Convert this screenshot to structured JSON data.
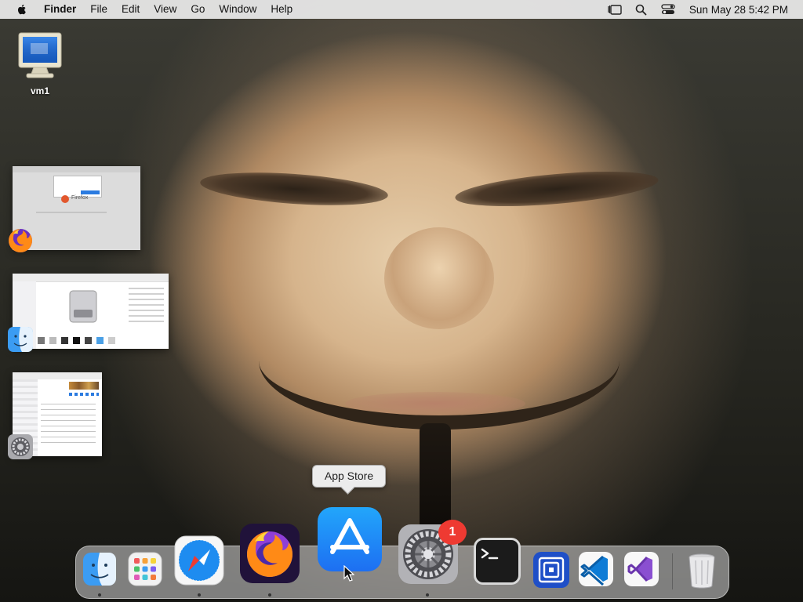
{
  "menubar": {
    "app_name": "Finder",
    "menus": [
      "File",
      "Edit",
      "View",
      "Go",
      "Window",
      "Help"
    ],
    "clock": "Sun May 28  5:42 PM",
    "status_icons": [
      "stage-manager-icon",
      "spotlight-search-icon",
      "control-center-icon"
    ]
  },
  "desktop": {
    "icons": [
      {
        "label": "vm1",
        "icon": "computer-monitor-icon"
      }
    ]
  },
  "stage_manager": {
    "groups": [
      {
        "app": "Firefox",
        "icon": "firefox-icon",
        "thumb_text": "Firefox"
      },
      {
        "app": "Finder",
        "icon": "finder-icon"
      },
      {
        "app": "System Preferences",
        "icon": "system-preferences-icon"
      }
    ]
  },
  "tooltip": {
    "text": "App Store"
  },
  "dock": {
    "items": [
      {
        "name": "Finder",
        "icon": "finder-icon",
        "running": true
      },
      {
        "name": "Launchpad",
        "icon": "launchpad-icon",
        "running": false
      },
      {
        "name": "Safari",
        "icon": "safari-icon",
        "running": true
      },
      {
        "name": "Firefox",
        "icon": "firefox-icon",
        "running": true
      },
      {
        "name": "App Store",
        "icon": "app-store-icon",
        "running": false
      },
      {
        "name": "System Preferences",
        "icon": "system-preferences-icon",
        "running": true,
        "badge": "1"
      },
      {
        "name": "Terminal",
        "icon": "terminal-icon",
        "running": false
      },
      {
        "name": "Remote Desktop",
        "icon": "remote-desktop-icon",
        "running": false
      },
      {
        "name": "Visual Studio Code",
        "icon": "vscode-icon",
        "running": false
      },
      {
        "name": "Visual Studio",
        "icon": "visual-studio-icon",
        "running": false
      },
      {
        "name": "Trash",
        "icon": "trash-icon",
        "running": false
      }
    ]
  },
  "colors": {
    "menubar_bg": "#ebebeb",
    "badge_red": "#ee3a32",
    "appstore_blue": "#1d8ff5",
    "vscode_blue": "#0e7cd6",
    "vs_purple": "#8a4fd1"
  }
}
